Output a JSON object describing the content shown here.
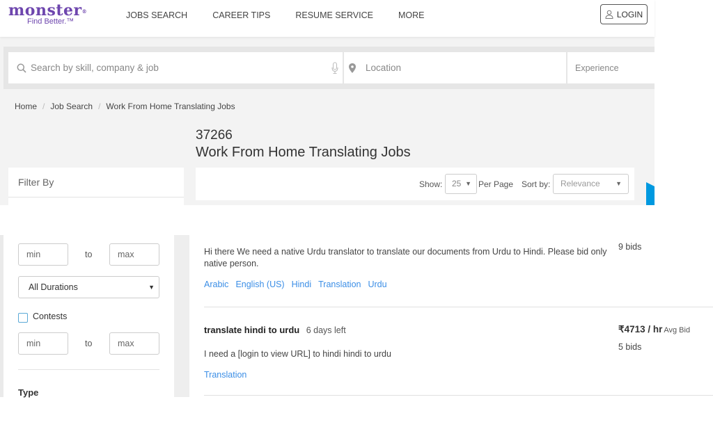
{
  "header": {
    "logo": {
      "word": "monster",
      "reg": "®",
      "tagline": "Find Better.™"
    },
    "nav": [
      "JOBS SEARCH",
      "CAREER TIPS",
      "RESUME SERVICE",
      "MORE"
    ],
    "login_label": "LOGIN"
  },
  "search": {
    "skill_placeholder": "Search by skill, company & job",
    "location_placeholder": "Location",
    "experience_placeholder": "Experience"
  },
  "breadcrumb": [
    "Home",
    "Job Search",
    "Work From Home Translating Jobs"
  ],
  "results": {
    "count": "37266",
    "title": "Work From Home Translating Jobs"
  },
  "filter": {
    "title": "Filter By"
  },
  "sort_bar": {
    "show_label": "Show:",
    "show_value": "25",
    "per_page_label": "Per Page",
    "sort_label": "Sort by:",
    "sort_value": "Relevance"
  },
  "sidebar": {
    "range1": {
      "min": "min",
      "to": "to",
      "max": "max"
    },
    "duration": "All Durations",
    "contests_label": "Contests",
    "contests_checked": false,
    "range2": {
      "min": "min",
      "to": "to",
      "max": "max"
    },
    "type_heading": "Type"
  },
  "jobs": [
    {
      "description": "Hi there We need a native Urdu translator to translate our documents from Urdu to Hindi. Please bid only native person.",
      "tags": [
        "Arabic",
        "English (US)",
        "Hindi",
        "Translation",
        "Urdu"
      ],
      "bids": "9 bids"
    },
    {
      "title": "translate hindi to urdu",
      "time_left": "6 days left",
      "price": "₹4713 / hr",
      "price_note": "Avg Bid",
      "bids": "5 bids",
      "description": "I need a [login to view URL] to hindi hindi to urdu",
      "tags": [
        "Translation"
      ]
    }
  ],
  "colors": {
    "brand": "#6e46ae",
    "link": "#3b8ee6",
    "accent_tab": "#0099e0"
  }
}
